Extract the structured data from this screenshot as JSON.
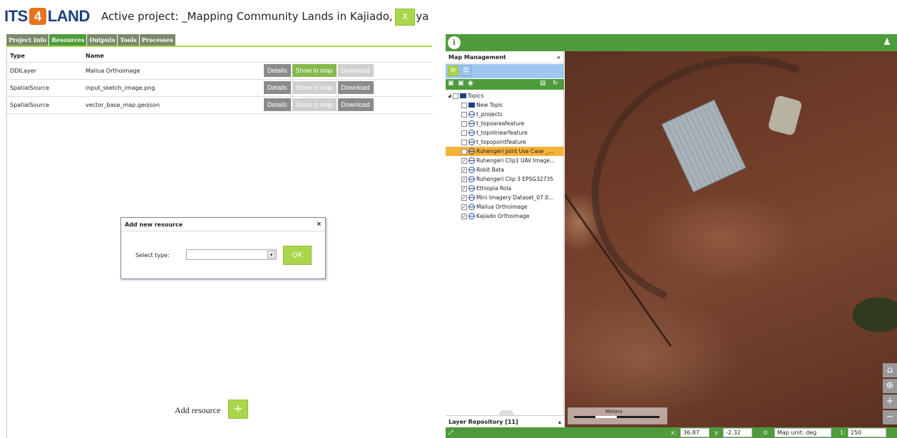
{
  "header": {
    "logo": {
      "its": "ITS",
      "four": "4",
      "land": "LAND"
    },
    "active_project": "Active project: _Mapping Community Lands in Kajiado, Kenya",
    "close_label": "X"
  },
  "tabs": [
    {
      "label": "Project Info",
      "active": false
    },
    {
      "label": "Resources",
      "active": true
    },
    {
      "label": "Outputs",
      "active": false
    },
    {
      "label": "Tools",
      "active": false
    },
    {
      "label": "Processes",
      "active": false
    }
  ],
  "resources": {
    "columns": {
      "type": "Type",
      "name": "Name"
    },
    "rows": [
      {
        "type": "DDILayer",
        "name": "Mailua Orthoimage",
        "details": "Details",
        "show": "Show in map",
        "download": "Download",
        "show_enabled": true,
        "download_enabled": false
      },
      {
        "type": "SpatialSource",
        "name": "input_sketch_image.png",
        "details": "Details",
        "show": "Show in map",
        "download": "Download",
        "show_enabled": false,
        "download_enabled": true
      },
      {
        "type": "SpatialSource",
        "name": "vector_base_map.geojson",
        "details": "Details",
        "show": "Show in map",
        "download": "Download",
        "show_enabled": false,
        "download_enabled": true
      }
    ],
    "add_label": "Add resource",
    "add_button": "+"
  },
  "dialog": {
    "title": "Add new resource",
    "close": "×",
    "select_label": "Select type:",
    "select_value": "",
    "ok_label": "OK"
  },
  "map_management": {
    "title": "Map Management",
    "collapse_icon": "«",
    "tree": [
      {
        "label": "Topics",
        "kind": "root",
        "checked": false
      },
      {
        "label": "New Topic",
        "kind": "folder",
        "checked": false
      },
      {
        "label": "t_projects",
        "kind": "layer",
        "checked": false
      },
      {
        "label": "t_topoareafeature",
        "kind": "layer",
        "checked": false
      },
      {
        "label": "t_topolinearfeature",
        "kind": "layer",
        "checked": false
      },
      {
        "label": "t_topopointfeature",
        "kind": "layer",
        "checked": false
      },
      {
        "label": "Ruhengeri Joint Use Case _...",
        "kind": "layer",
        "checked": false,
        "selected": true
      },
      {
        "label": "Ruhengeri Clip1 UAV Image...",
        "kind": "layer",
        "checked": true
      },
      {
        "label": "Robit Bata",
        "kind": "layer",
        "checked": true
      },
      {
        "label": "Ruhengeri Clip 3 EPSG32735",
        "kind": "layer",
        "checked": true
      },
      {
        "label": "Ethiopia Rola",
        "kind": "layer",
        "checked": true
      },
      {
        "label": "Mini Imagery Dataset_07.0...",
        "kind": "layer",
        "checked": true
      },
      {
        "label": "Mailua Orthoimage",
        "kind": "layer",
        "checked": true
      },
      {
        "label": "Kajiado Orthoimage",
        "kind": "layer",
        "checked": true
      }
    ],
    "repository": "Layer Repository [11]"
  },
  "map": {
    "scale_label": "Meters"
  },
  "statusbar": {
    "x_label": "x:",
    "x_value": "36.87",
    "y_label": "y:",
    "y_value": "-2.32",
    "map_unit": "Map unit: deg",
    "scale_label": "1:",
    "scale_value": "250"
  },
  "colors": {
    "green_dark": "#4e9b3c",
    "green_light": "#a9d64a",
    "selected_row": "#f6b13a",
    "logo_blue": "#1f3f80",
    "logo_orange": "#e8731e"
  }
}
